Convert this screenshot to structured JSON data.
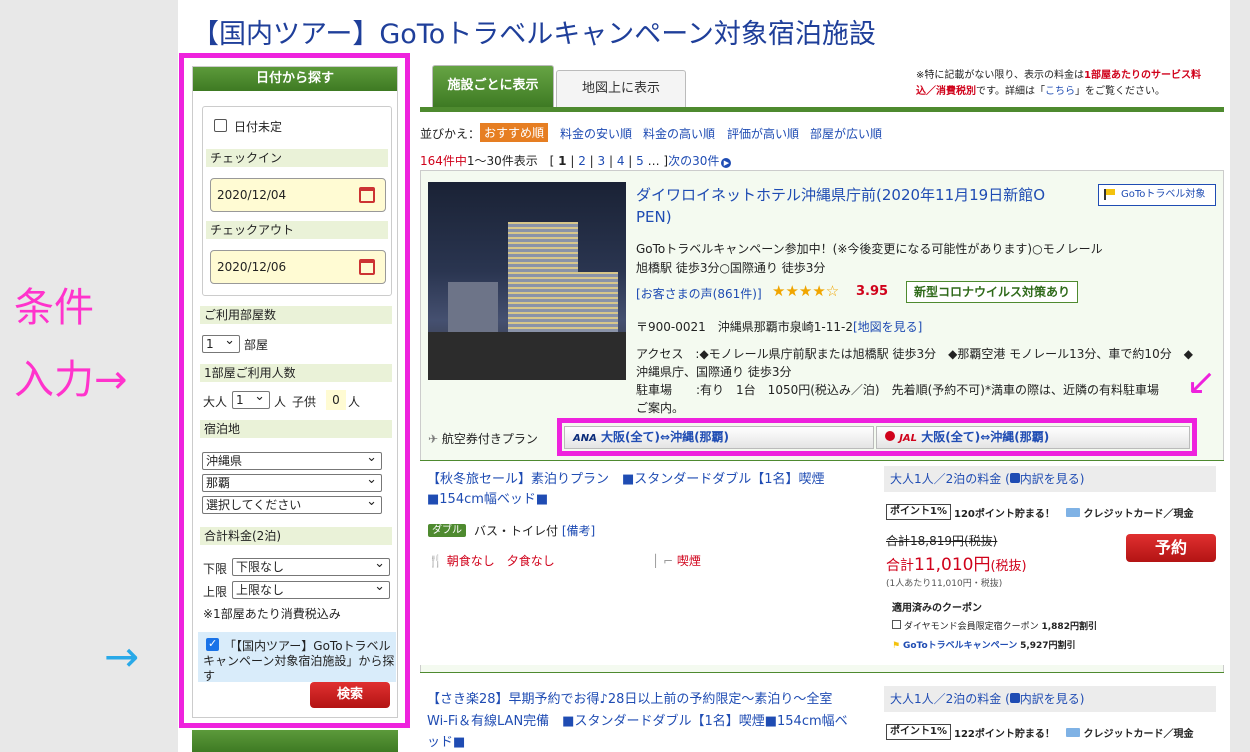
{
  "annotations": {
    "left_label_line1": "条件",
    "left_label_line2": "入力→",
    "arrow_blue": "→",
    "arrow_pink": "↙"
  },
  "page_title": "【国内ツアー】GoToトラベルキャンペーン対象宿泊施設",
  "sidebar": {
    "header": "日付から探す",
    "date_undecided": "日付未定",
    "checkin_label": "チェックイン",
    "checkin_value": "2020/12/04",
    "checkout_label": "チェックアウト",
    "checkout_value": "2020/12/06",
    "rooms_label": "ご利用部屋数",
    "rooms_value": "1",
    "rooms_unit": "部屋",
    "people_label": "1部屋ご利用人数",
    "adult_label": "大人",
    "adult_value": "1",
    "adult_unit": "人",
    "child_label": "子供",
    "child_value": "0",
    "child_unit": "人",
    "stay_label": "宿泊地",
    "pref_value": "沖縄県",
    "city_value": "那覇",
    "area_value": "選択してください",
    "price_label": "合計料金(2泊)",
    "lower_label": "下限",
    "lower_value": "下限なし",
    "upper_label": "上限",
    "upper_value": "上限なし",
    "tax_note": "※1部屋あたり消費税込み",
    "campaign_check_l1": "「【国内ツアー】GoToトラベル",
    "campaign_check_l2": "キャンペーン対象宿泊施設」から探",
    "campaign_check_l3": "す",
    "search_button": "検索"
  },
  "tabs": {
    "by_facility": "施設ごとに表示",
    "on_map": "地図上に表示"
  },
  "notice": {
    "l1a": "※特に記載がない限り、表示の料金は",
    "l1b": "1部屋あたりのサービス料",
    "l2a": "込／消費税別",
    "l2b": "です。詳細は「",
    "l2c": "こちら",
    "l2d": "」をご覧ください。"
  },
  "sort": {
    "label": "並びかえ：",
    "options": [
      "おすすめ順",
      "料金の安い順",
      "料金の高い順",
      "評価が高い順",
      "部屋が広い順"
    ]
  },
  "paging": {
    "count": "164件中",
    "range": "1〜30件表示",
    "open": "[",
    "p1": "1",
    "p2": "2",
    "p3": "3",
    "p4": "4",
    "p5": "5",
    "ellipsis": "…",
    "close": "]",
    "next": "次の30件"
  },
  "hotel": {
    "name_l1": "ダイワロイネットホテル沖縄県庁前(2020年11月19日新館O",
    "name_l2": "PEN)",
    "goto_badge": "GoToトラベル対象",
    "catch_l1": "GoToトラベルキャンペーン参加中！(※今後変更になる可能性があります)○モノレール",
    "catch_l2": "旭橋駅 徒歩3分○国際通り 徒歩3分",
    "reviews": "[お客さまの声(861件)]",
    "stars": "★★★★☆",
    "rating": "3.95",
    "covid_badge": "新型コロナウイルス対策あり",
    "address": "〒900-0021　沖縄県那覇市泉崎1-11-2",
    "map_link": "[地図を見る]",
    "access_l1": "アクセス　:◆モノレール県庁前駅または旭橋駅 徒歩3分　◆那覇空港 モノレール13分、車で約10分　◆",
    "access_l2": "沖縄県庁、国際通り 徒歩3分",
    "parking_l1": "駐車場　　:有り　1台　1050円(税込み／泊)　先着順(予約不可)*満車の際は、近隣の有料駐車場",
    "parking_l2": "ご案内。"
  },
  "air_plan": {
    "label": "航空券付きプラン",
    "ana": "ANA",
    "ana_route": "大阪(全て)⇔沖縄(那覇)",
    "jal": "JAL",
    "jal_route": "大阪(全て)⇔沖縄(那覇)"
  },
  "plans": [
    {
      "title_l1": "【秋冬旅セール】素泊りプラン　■スタンダードダブル【1名】喫煙",
      "title_l2": "■154cm幅ベッド■",
      "room_tag": "ダブル",
      "bath": "バス・トイレ付",
      "note_link": "[備考]",
      "meal": "朝食なし　夕食なし",
      "smoking": "喫煙",
      "price_head": "大人1人／2泊の料金",
      "breakdown": "内訳を見る",
      "points_badge": "ポイント1%",
      "points": "120ポイント貯まる！",
      "payment": "クレジットカード／現金",
      "old_total": "合計18,819円(税抜)",
      "total_prefix": "合計",
      "total_amount": "11,010円",
      "total_suffix": "(税抜)",
      "per_person": "(1人あたり11,010円・税抜)",
      "reserve": "予約",
      "coupon_head": "適用済みのクーポン",
      "coupon1": "ダイヤモンド会員限定宿クーポン",
      "coupon1_amt": "1,882円割引",
      "coupon2": "GoToトラベルキャンペーン",
      "coupon2_amt": "5,927円割引"
    },
    {
      "title_l1": "【さき楽28】早期予約でお得♪28日以上前の予約限定～素泊り～全室",
      "title_l2": "Wi-Fi＆有線LAN完備　■スタンダードダブル【1名】喫煙■154cm幅ベ",
      "title_l3": "ッド■",
      "price_head": "大人1人／2泊の料金",
      "breakdown": "内訳を見る",
      "points_badge": "ポイント1%",
      "points": "122ポイント貯まる！",
      "payment": "クレジットカード／現金"
    }
  ],
  "colors": {
    "accent_green": "#4e8a2f",
    "link_blue": "#1f4cb3",
    "price_red": "#d0021b",
    "annotation_pink": "#ee22dd",
    "annotation_blue": "#29a9e8"
  }
}
